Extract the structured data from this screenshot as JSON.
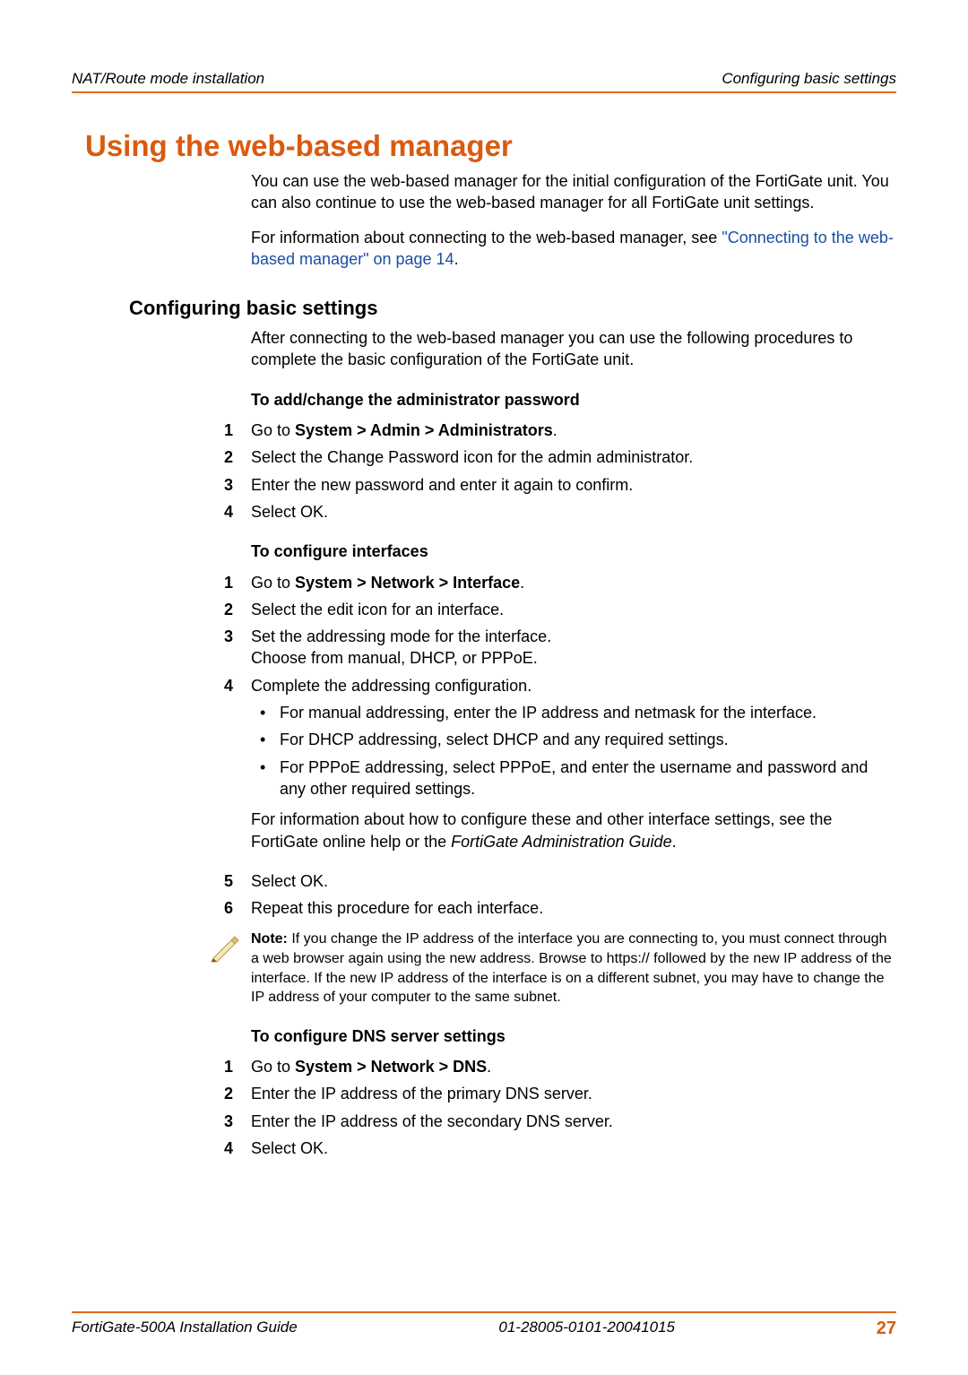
{
  "header": {
    "left": "NAT/Route mode installation",
    "right": "Configuring basic settings"
  },
  "title": "Using the web-based manager",
  "intro": {
    "p1": "You can use the web-based manager for the initial configuration of the FortiGate unit. You can also continue to use the web-based manager for all FortiGate unit settings.",
    "p2_prefix": "For information about connecting to the web-based manager, see ",
    "p2_link": "\"Connecting to the web-based manager\" on page 14",
    "p2_suffix": "."
  },
  "section_heading": "Configuring basic settings",
  "section_intro": "After connecting to the web-based manager you can use the following procedures to complete the basic configuration of the FortiGate unit.",
  "proc1": {
    "title": "To add/change the administrator password",
    "s1_prefix": "Go to ",
    "s1_bold": "System > Admin > Administrators",
    "s1_suffix": ".",
    "s2": "Select the Change Password icon for the admin administrator.",
    "s3": "Enter the new password and enter it again to confirm.",
    "s4": "Select OK."
  },
  "proc2": {
    "title": "To configure interfaces",
    "s1_prefix": "Go to ",
    "s1_bold": "System > Network > Interface",
    "s1_suffix": ".",
    "s2": "Select the edit icon for an interface.",
    "s3a": "Set the addressing mode for the interface.",
    "s3b": "Choose from manual, DHCP, or PPPoE.",
    "s4": "Complete the addressing configuration.",
    "b1": "For manual addressing, enter the IP address and netmask for the interface.",
    "b2": "For DHCP addressing, select DHCP and any required settings.",
    "b3": "For PPPoE addressing, select PPPoE, and enter the username and password and any other required settings.",
    "after_bullets_prefix": "For information about how to configure these and other interface settings, see the FortiGate online help or the ",
    "after_bullets_italic": "FortiGate Administration Guide",
    "after_bullets_suffix": ".",
    "s5": "Select OK.",
    "s6": "Repeat this procedure for each interface."
  },
  "note": {
    "label": "Note: ",
    "text": "If you change the IP address of the interface you are connecting to, you must connect through a web browser again using the new address. Browse to https:// followed by the new IP address of the interface. If the new IP address of the interface is on a different subnet, you may have to change the IP address of your computer to the same subnet."
  },
  "proc3": {
    "title": "To configure DNS server settings",
    "s1_prefix": "Go to ",
    "s1_bold": "System > Network > DNS",
    "s1_suffix": ".",
    "s2": "Enter the IP address of the primary DNS server.",
    "s3": "Enter the IP address of the secondary DNS server.",
    "s4": "Select OK."
  },
  "footer": {
    "left": "FortiGate-500A Installation Guide",
    "mid": "01-28005-0101-20041015",
    "page": "27"
  },
  "nums": {
    "n1": "1",
    "n2": "2",
    "n3": "3",
    "n4": "4",
    "n5": "5",
    "n6": "6"
  },
  "bullet": "•"
}
